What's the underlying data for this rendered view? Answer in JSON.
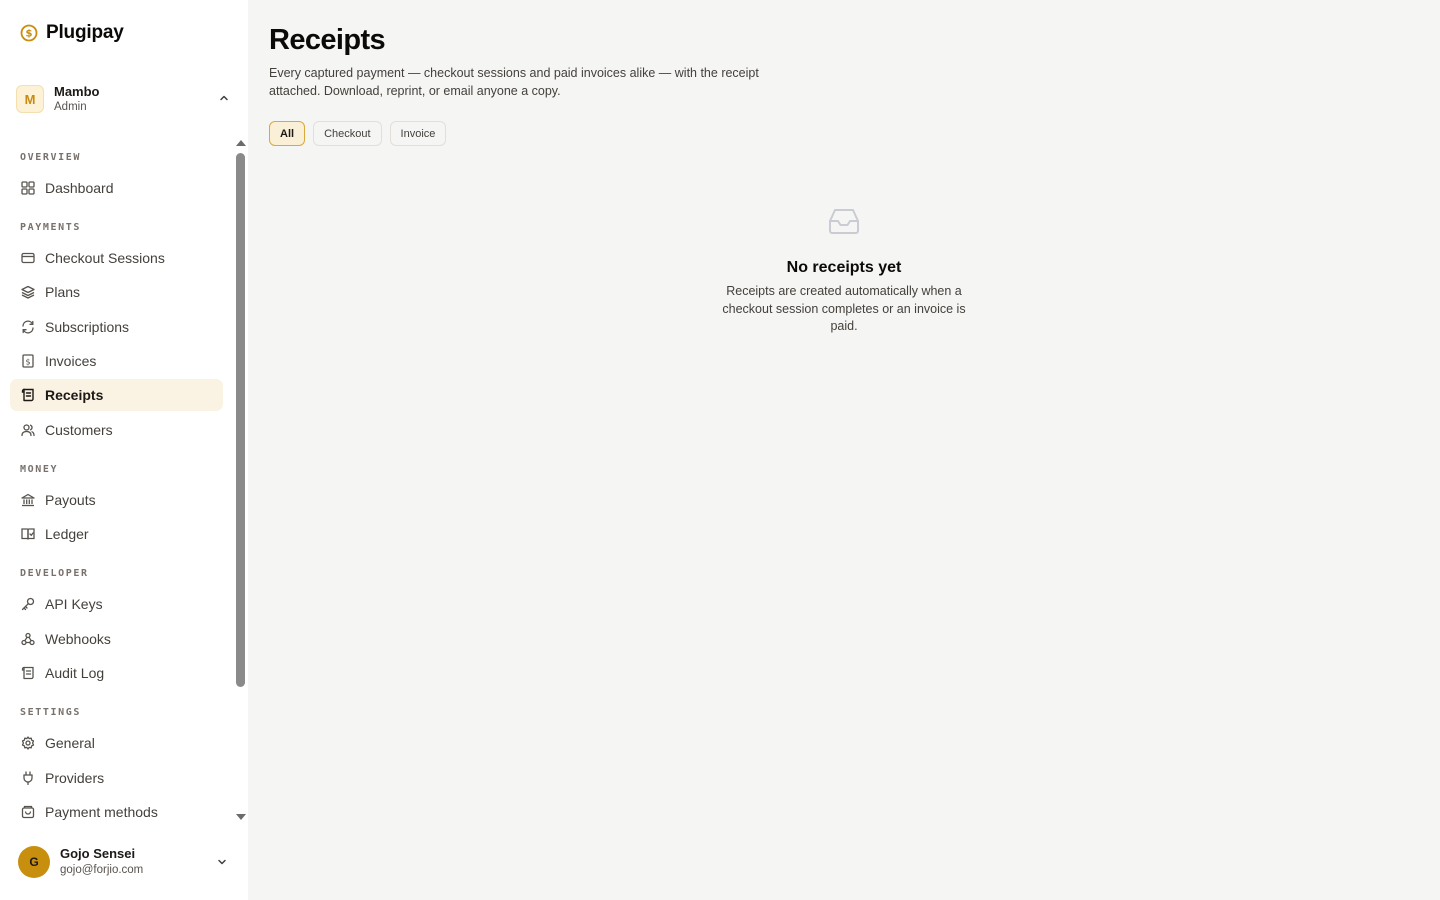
{
  "brand": {
    "name": "Plugipay",
    "logo_icon": "dollar-coin-icon",
    "accent": "#c88e0e"
  },
  "workspace": {
    "initial": "M",
    "name": "Mambo",
    "role": "Admin"
  },
  "nav": {
    "sections": [
      {
        "label": "OVERVIEW",
        "items": [
          {
            "label": "Dashboard",
            "icon": "grid-icon"
          }
        ]
      },
      {
        "label": "PAYMENTS",
        "items": [
          {
            "label": "Checkout Sessions",
            "icon": "credit-card-icon"
          },
          {
            "label": "Plans",
            "icon": "layers-icon"
          },
          {
            "label": "Subscriptions",
            "icon": "refresh-icon"
          },
          {
            "label": "Invoices",
            "icon": "invoice-icon"
          },
          {
            "label": "Receipts",
            "icon": "receipt-icon",
            "active": true
          },
          {
            "label": "Customers",
            "icon": "users-icon"
          }
        ]
      },
      {
        "label": "MONEY",
        "items": [
          {
            "label": "Payouts",
            "icon": "bank-icon"
          },
          {
            "label": "Ledger",
            "icon": "book-icon"
          }
        ]
      },
      {
        "label": "DEVELOPER",
        "items": [
          {
            "label": "API Keys",
            "icon": "key-icon"
          },
          {
            "label": "Webhooks",
            "icon": "webhook-icon"
          },
          {
            "label": "Audit Log",
            "icon": "scroll-icon"
          }
        ]
      },
      {
        "label": "SETTINGS",
        "items": [
          {
            "label": "General",
            "icon": "gear-icon"
          },
          {
            "label": "Providers",
            "icon": "plug-icon"
          },
          {
            "label": "Payment methods",
            "icon": "wallet-icon"
          }
        ]
      }
    ]
  },
  "user": {
    "initial": "G",
    "name": "Gojo Sensei",
    "email": "gojo@forjio.com"
  },
  "page": {
    "title": "Receipts",
    "description": "Every captured payment — checkout sessions and paid invoices alike — with the receipt attached. Download, reprint, or email anyone a copy.",
    "filters": [
      {
        "label": "All",
        "active": true
      },
      {
        "label": "Checkout",
        "active": false
      },
      {
        "label": "Invoice",
        "active": false
      }
    ]
  },
  "empty_state": {
    "icon": "inbox-icon",
    "title": "No receipts yet",
    "text": "Receipts are created automatically when a checkout session completes or an invoice is paid."
  }
}
